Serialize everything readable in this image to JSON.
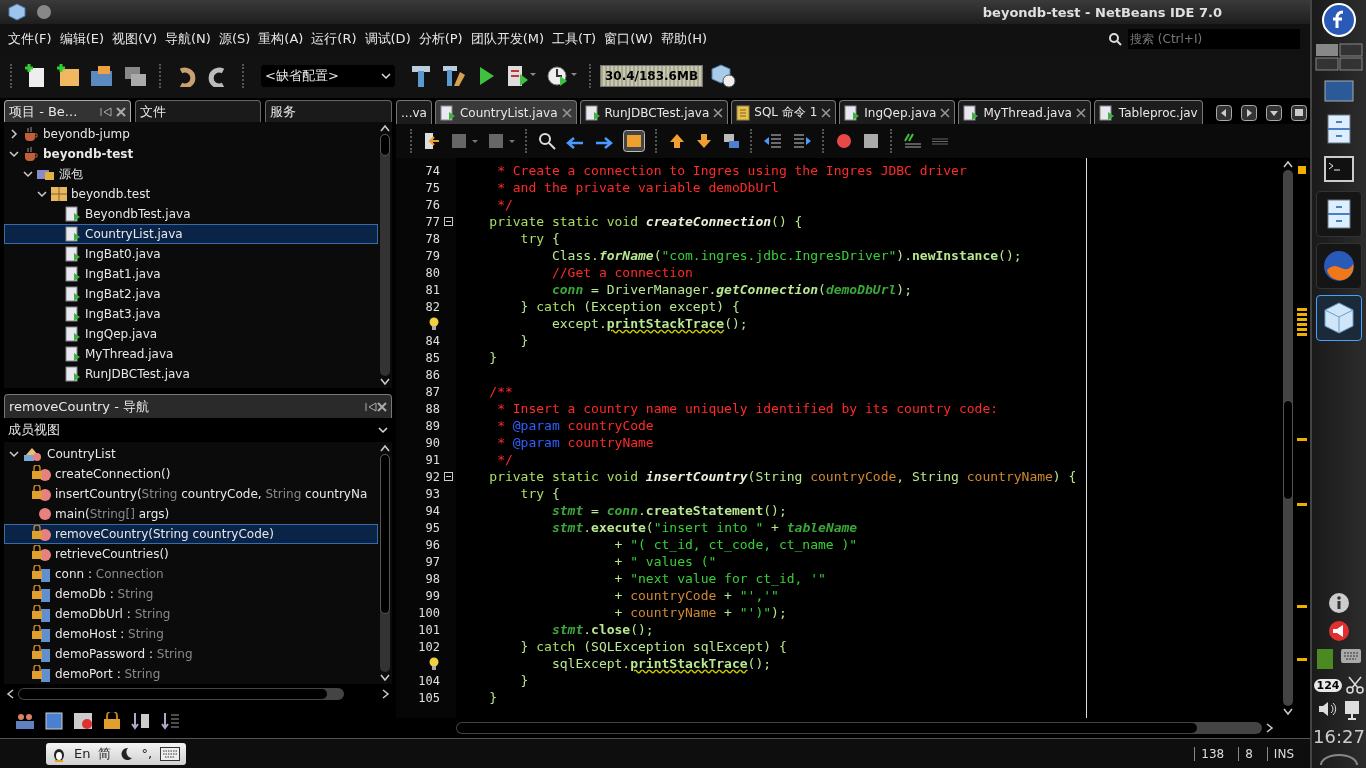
{
  "window": {
    "title": "beyondb-test - NetBeans IDE 7.0"
  },
  "menu": [
    "文件(F)",
    "编辑(E)",
    "视图(V)",
    "导航(N)",
    "源(S)",
    "重构(A)",
    "运行(R)",
    "调试(D)",
    "分析(P)",
    "团队开发(M)",
    "工具(T)",
    "窗口(W)",
    "帮助(H)"
  ],
  "search": {
    "placeholder": "搜索 (Ctrl+I)"
  },
  "toolbar": {
    "config": "<缺省配置>",
    "memory": "30.4/183.6MB"
  },
  "projects_panel": {
    "tabs": [
      {
        "label": "项目 - Be...",
        "selected": true
      },
      {
        "label": "文件",
        "selected": false
      },
      {
        "label": "服务",
        "selected": false
      }
    ],
    "tree": [
      {
        "label": "beyondb-jump",
        "kind": "project",
        "main_project": false,
        "expanded": false,
        "selected": false
      },
      {
        "label": "beyondb-test",
        "kind": "project",
        "main_project": true,
        "expanded": true,
        "selected": false,
        "children": [
          {
            "label": "源包",
            "kind": "sources",
            "expanded": true,
            "selected": false,
            "children": [
              {
                "label": "beyondb.test",
                "kind": "package",
                "expanded": true,
                "selected": false,
                "children": [
                  {
                    "label": "BeyondbTest.java",
                    "kind": "file",
                    "selected": false
                  },
                  {
                    "label": "CountryList.java",
                    "kind": "file",
                    "selected": true
                  },
                  {
                    "label": "IngBat0.java",
                    "kind": "file",
                    "selected": false
                  },
                  {
                    "label": "IngBat1.java",
                    "kind": "file",
                    "selected": false
                  },
                  {
                    "label": "IngBat2.java",
                    "kind": "file",
                    "selected": false
                  },
                  {
                    "label": "IngBat3.java",
                    "kind": "file",
                    "selected": false
                  },
                  {
                    "label": "IngQep.java",
                    "kind": "file",
                    "selected": false
                  },
                  {
                    "label": "MyThread.java",
                    "kind": "file",
                    "selected": false
                  },
                  {
                    "label": "RunJDBCTest.java",
                    "kind": "file",
                    "selected": false
                  }
                ]
              }
            ]
          }
        ]
      }
    ]
  },
  "navigator": {
    "title": "removeCountry - 导航",
    "view": "成员视图",
    "class": {
      "label": "CountryList",
      "expanded": true
    },
    "members": [
      {
        "kind": "method",
        "locked": true,
        "selected": false,
        "parts": [
          {
            "kind": "name",
            "s": "createConnection()"
          }
        ]
      },
      {
        "kind": "method",
        "locked": true,
        "selected": false,
        "parts": [
          {
            "kind": "name",
            "s": "insertCountry("
          },
          {
            "kind": "type",
            "s": "String"
          },
          {
            "kind": "name",
            "s": " countryCode, "
          },
          {
            "kind": "type",
            "s": "String"
          },
          {
            "kind": "name",
            "s": " countryNa"
          }
        ]
      },
      {
        "kind": "method",
        "locked": false,
        "selected": false,
        "parts": [
          {
            "kind": "name",
            "s": "main("
          },
          {
            "kind": "type",
            "s": "String[]"
          },
          {
            "kind": "name",
            "s": " args)"
          }
        ]
      },
      {
        "kind": "method",
        "locked": true,
        "selected": true,
        "parts": [
          {
            "kind": "name",
            "s": "removeCountry(String countryCode)"
          }
        ]
      },
      {
        "kind": "method",
        "locked": true,
        "selected": false,
        "parts": [
          {
            "kind": "name",
            "s": "retrieveCountries()"
          }
        ]
      },
      {
        "kind": "field",
        "locked": true,
        "selected": false,
        "parts": [
          {
            "kind": "name",
            "s": "conn : "
          },
          {
            "kind": "type",
            "s": "Connection"
          }
        ]
      },
      {
        "kind": "field",
        "locked": true,
        "selected": false,
        "parts": [
          {
            "kind": "name",
            "s": "demoDb : "
          },
          {
            "kind": "type",
            "s": "String"
          }
        ]
      },
      {
        "kind": "field",
        "locked": true,
        "selected": false,
        "parts": [
          {
            "kind": "name",
            "s": "demoDbUrl : "
          },
          {
            "kind": "type",
            "s": "String"
          }
        ]
      },
      {
        "kind": "field",
        "locked": true,
        "selected": false,
        "parts": [
          {
            "kind": "name",
            "s": "demoHost : "
          },
          {
            "kind": "type",
            "s": "String"
          }
        ]
      },
      {
        "kind": "field",
        "locked": true,
        "selected": false,
        "parts": [
          {
            "kind": "name",
            "s": "demoPassword : "
          },
          {
            "kind": "type",
            "s": "String"
          }
        ]
      },
      {
        "kind": "field",
        "locked": true,
        "selected": false,
        "parts": [
          {
            "kind": "name",
            "s": "demoPort : "
          },
          {
            "kind": "type",
            "s": "String"
          }
        ]
      }
    ]
  },
  "editor": {
    "tabs": [
      {
        "label": "...va",
        "kind": "none",
        "closable": false,
        "selected": false
      },
      {
        "label": "CountryList.java",
        "kind": "java",
        "closable": true,
        "selected": true
      },
      {
        "label": "RunJDBCTest.java",
        "kind": "java",
        "closable": true,
        "selected": false
      },
      {
        "label": "SQL 命令 1",
        "kind": "sql",
        "closable": true,
        "selected": false
      },
      {
        "label": "IngQep.java",
        "kind": "java",
        "closable": true,
        "selected": false
      },
      {
        "label": "MyThread.java",
        "kind": "java",
        "closable": true,
        "selected": false
      },
      {
        "label": "Tableproc.jav",
        "kind": "java",
        "closable": false,
        "selected": false
      }
    ],
    "lines": [
      {
        "number": "74",
        "t": [
          {
            "kind": "comment",
            "s": "     * Create a connection to Ingres using the Ingres JDBC driver"
          }
        ]
      },
      {
        "number": "75",
        "t": [
          {
            "kind": "comment",
            "s": "     * and the private variable demoDbUrl"
          }
        ]
      },
      {
        "number": "76",
        "t": [
          {
            "kind": "comment",
            "s": "     */"
          }
        ]
      },
      {
        "number": "77",
        "fold": true,
        "t": [
          {
            "kind": "kw",
            "s": "    private static void "
          },
          {
            "kind": "method",
            "s": "createConnection"
          },
          {
            "kind": "plain",
            "s": "() {"
          }
        ]
      },
      {
        "number": "78",
        "t": [
          {
            "kind": "kw",
            "s": "        try"
          },
          {
            "kind": "plain",
            "s": " {"
          }
        ]
      },
      {
        "number": "79",
        "t": [
          {
            "kind": "plain",
            "s": "            Class."
          },
          {
            "kind": "static",
            "s": "forName"
          },
          {
            "kind": "plain",
            "s": "("
          },
          {
            "kind": "string",
            "s": "\"com.ingres.jdbc.IngresDriver\""
          },
          {
            "kind": "plain",
            "s": ")."
          },
          {
            "kind": "call",
            "s": "newInstance"
          },
          {
            "kind": "plain",
            "s": "();"
          }
        ]
      },
      {
        "number": "80",
        "t": [
          {
            "kind": "comment",
            "s": "            //Get a connection"
          }
        ]
      },
      {
        "number": "81",
        "t": [
          {
            "kind": "field",
            "s": "            conn"
          },
          {
            "kind": "plain",
            "s": " = DriverManager."
          },
          {
            "kind": "static",
            "s": "getConnection"
          },
          {
            "kind": "plain",
            "s": "("
          },
          {
            "kind": "field",
            "s": "demoDbUrl"
          },
          {
            "kind": "plain",
            "s": ");"
          }
        ]
      },
      {
        "number": "82",
        "t": [
          {
            "kind": "plain",
            "s": "        } "
          },
          {
            "kind": "kw",
            "s": "catch"
          },
          {
            "kind": "plain",
            "s": " (Exception except) {"
          }
        ]
      },
      {
        "hint": true,
        "t": [
          {
            "kind": "plain",
            "s": "            except."
          },
          {
            "kind": "warn",
            "s": "printStackTrace"
          },
          {
            "kind": "plain",
            "s": "();"
          }
        ]
      },
      {
        "number": "84",
        "t": [
          {
            "kind": "plain",
            "s": "        }"
          }
        ]
      },
      {
        "number": "85",
        "t": [
          {
            "kind": "plain",
            "s": "    }"
          }
        ]
      },
      {
        "number": "86"
      },
      {
        "number": "87",
        "t": [
          {
            "kind": "comment",
            "s": "    /**"
          }
        ]
      },
      {
        "number": "88",
        "t": [
          {
            "kind": "comment",
            "s": "     * Insert a country name uniquely identified by its country code:"
          }
        ]
      },
      {
        "number": "89",
        "t": [
          {
            "kind": "comment",
            "s": "     * "
          },
          {
            "kind": "tag",
            "s": "@param"
          },
          {
            "kind": "comment",
            "s": " countryCode"
          }
        ]
      },
      {
        "number": "90",
        "t": [
          {
            "kind": "comment",
            "s": "     * "
          },
          {
            "kind": "tag",
            "s": "@param"
          },
          {
            "kind": "comment",
            "s": " countryName"
          }
        ]
      },
      {
        "number": "91",
        "t": [
          {
            "kind": "comment",
            "s": "     */"
          }
        ]
      },
      {
        "number": "92",
        "fold": true,
        "t": [
          {
            "kind": "kw",
            "s": "    private static void "
          },
          {
            "kind": "method",
            "s": "insertCountry"
          },
          {
            "kind": "plain",
            "s": "(String "
          },
          {
            "kind": "param",
            "s": "countryCode"
          },
          {
            "kind": "plain",
            "s": ", String "
          },
          {
            "kind": "param",
            "s": "countryName"
          },
          {
            "kind": "plain",
            "s": ") {"
          }
        ]
      },
      {
        "number": "93",
        "t": [
          {
            "kind": "kw",
            "s": "        try"
          },
          {
            "kind": "plain",
            "s": " {"
          }
        ]
      },
      {
        "number": "94",
        "t": [
          {
            "kind": "field",
            "s": "            stmt"
          },
          {
            "kind": "plain",
            "s": " = "
          },
          {
            "kind": "field",
            "s": "conn"
          },
          {
            "kind": "plain",
            "s": "."
          },
          {
            "kind": "call",
            "s": "createStatement"
          },
          {
            "kind": "plain",
            "s": "();"
          }
        ]
      },
      {
        "number": "95",
        "t": [
          {
            "kind": "field",
            "s": "            stmt"
          },
          {
            "kind": "plain",
            "s": "."
          },
          {
            "kind": "call",
            "s": "execute"
          },
          {
            "kind": "plain",
            "s": "("
          },
          {
            "kind": "string",
            "s": "\"insert into \""
          },
          {
            "kind": "plain",
            "s": " + "
          },
          {
            "kind": "field",
            "s": "tableName"
          }
        ]
      },
      {
        "number": "96",
        "t": [
          {
            "kind": "plain",
            "s": "                    + "
          },
          {
            "kind": "string",
            "s": "\"( ct_id, ct_code, ct_name )\""
          }
        ]
      },
      {
        "number": "97",
        "t": [
          {
            "kind": "plain",
            "s": "                    + "
          },
          {
            "kind": "string",
            "s": "\" values (\""
          }
        ]
      },
      {
        "number": "98",
        "t": [
          {
            "kind": "plain",
            "s": "                    + "
          },
          {
            "kind": "string",
            "s": "\"next value for ct_id, '\""
          }
        ]
      },
      {
        "number": "99",
        "t": [
          {
            "kind": "plain",
            "s": "                    + "
          },
          {
            "kind": "param",
            "s": "countryCode"
          },
          {
            "kind": "plain",
            "s": " + "
          },
          {
            "kind": "string",
            "s": "\"','\""
          }
        ]
      },
      {
        "number": "100",
        "t": [
          {
            "kind": "plain",
            "s": "                    + "
          },
          {
            "kind": "param",
            "s": "countryName"
          },
          {
            "kind": "plain",
            "s": " + "
          },
          {
            "kind": "string",
            "s": "\"')\""
          },
          {
            "kind": "plain",
            "s": ");"
          }
        ]
      },
      {
        "number": "101",
        "t": [
          {
            "kind": "field",
            "s": "            stmt"
          },
          {
            "kind": "plain",
            "s": "."
          },
          {
            "kind": "call",
            "s": "close"
          },
          {
            "kind": "plain",
            "s": "();"
          }
        ]
      },
      {
        "number": "102",
        "t": [
          {
            "kind": "plain",
            "s": "        } "
          },
          {
            "kind": "kw",
            "s": "catch"
          },
          {
            "kind": "plain",
            "s": " (SQLException sqlExcept) {"
          }
        ]
      },
      {
        "hint": true,
        "t": [
          {
            "kind": "plain",
            "s": "            sqlExcept."
          },
          {
            "kind": "warn",
            "s": "printStackTrace"
          },
          {
            "kind": "plain",
            "s": "();"
          }
        ]
      },
      {
        "number": "104",
        "t": [
          {
            "kind": "plain",
            "s": "        }"
          }
        ]
      },
      {
        "number": "105",
        "t": [
          {
            "kind": "plain",
            "s": "    }"
          }
        ]
      }
    ]
  },
  "input_method": {
    "language": "En",
    "script": "简",
    "punctuation": "°,"
  },
  "status_bar": {
    "line": "138",
    "column": "8",
    "mode": "INS"
  },
  "dock": {
    "badge": "124",
    "clock": "16:27"
  }
}
